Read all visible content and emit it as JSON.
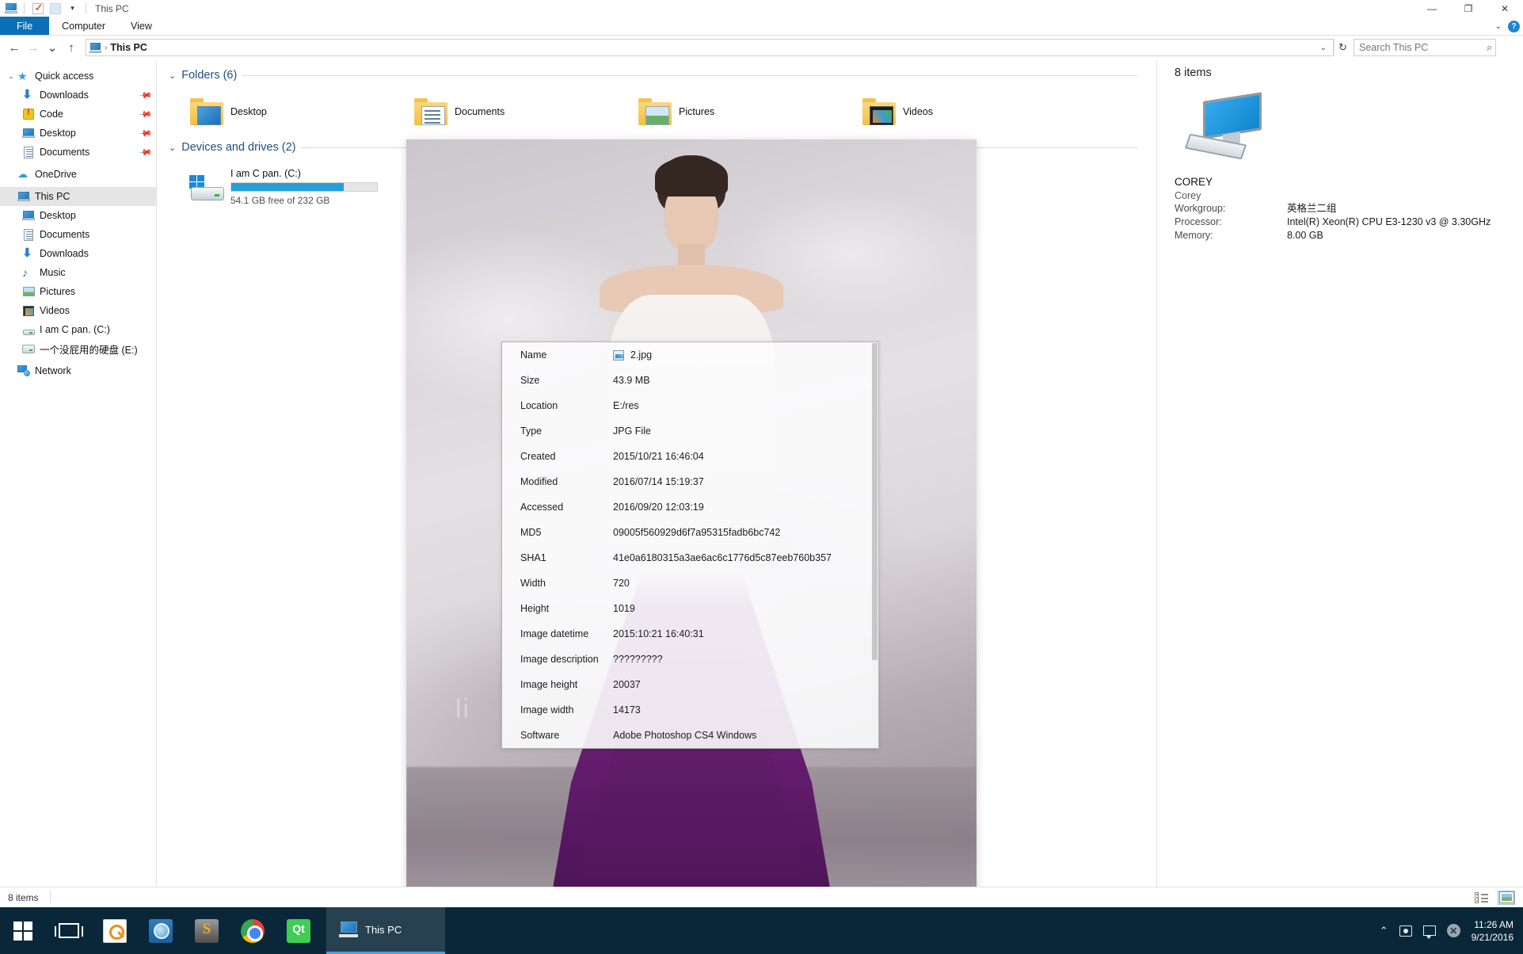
{
  "window": {
    "title": "This PC",
    "quick_access_icons": [
      "this-pc-icon",
      "checkbox-icon",
      "blank-icon",
      "dropdown-caret-icon"
    ],
    "controls": {
      "minimize": "—",
      "maximize": "❐",
      "close": "✕"
    }
  },
  "ribbon": {
    "tabs": [
      {
        "label": "File",
        "active": true
      },
      {
        "label": "Computer",
        "active": false
      },
      {
        "label": "View",
        "active": false
      }
    ],
    "collapse_icon": "chevron-down-icon",
    "help_icon": "help-icon",
    "help_label": "?"
  },
  "addressbar": {
    "back": "←",
    "forward": "→",
    "recent": "⌄",
    "up": "↑",
    "crumb_icon": "this-pc-icon",
    "crumb_sep": "›",
    "crumb_text": "This PC",
    "dropdown": "⌄",
    "refresh": "↻",
    "search_placeholder": "Search This PC",
    "search_value": "",
    "search_icon": "search-icon"
  },
  "sidebar": {
    "items": [
      {
        "label": "Quick access",
        "icon": "star-icon",
        "level": 0,
        "chevron": "⌄",
        "pinned": false,
        "selected": false
      },
      {
        "label": "Downloads",
        "icon": "download-icon",
        "level": 1,
        "chevron": "",
        "pinned": true,
        "selected": false
      },
      {
        "label": "Code",
        "icon": "folder-alert-icon",
        "level": 1,
        "chevron": "",
        "pinned": true,
        "selected": false
      },
      {
        "label": "Desktop",
        "icon": "monitor-icon",
        "level": 1,
        "chevron": "",
        "pinned": true,
        "selected": false
      },
      {
        "label": "Documents",
        "icon": "document-icon",
        "level": 1,
        "chevron": "",
        "pinned": true,
        "selected": false
      },
      {
        "label": "OneDrive",
        "icon": "cloud-icon",
        "level": 0,
        "chevron": "",
        "pinned": false,
        "selected": false
      },
      {
        "label": "This PC",
        "icon": "this-pc-icon",
        "level": 0,
        "chevron": "",
        "pinned": false,
        "selected": true
      },
      {
        "label": "Desktop",
        "icon": "monitor-icon",
        "level": 1,
        "chevron": "",
        "pinned": false,
        "selected": false
      },
      {
        "label": "Documents",
        "icon": "document-icon",
        "level": 1,
        "chevron": "",
        "pinned": false,
        "selected": false
      },
      {
        "label": "Downloads",
        "icon": "download-icon",
        "level": 1,
        "chevron": "",
        "pinned": false,
        "selected": false
      },
      {
        "label": "Music",
        "icon": "music-icon",
        "level": 1,
        "chevron": "",
        "pinned": false,
        "selected": false
      },
      {
        "label": "Pictures",
        "icon": "picture-icon",
        "level": 1,
        "chevron": "",
        "pinned": false,
        "selected": false
      },
      {
        "label": "Videos",
        "icon": "video-icon",
        "level": 1,
        "chevron": "",
        "pinned": false,
        "selected": false
      },
      {
        "label": "I am C pan. (C:)",
        "icon": "windows-drive-icon",
        "level": 1,
        "chevron": "",
        "pinned": false,
        "selected": false
      },
      {
        "label": "一个没屁用的硬盘 (E:)",
        "icon": "drive-icon",
        "level": 1,
        "chevron": "",
        "pinned": false,
        "selected": false
      },
      {
        "label": "Network",
        "icon": "network-icon",
        "level": 0,
        "chevron": "",
        "pinned": false,
        "selected": false
      }
    ]
  },
  "content": {
    "folders_group": {
      "chevron": "⌄",
      "title": "Folders (6)",
      "tiles": [
        {
          "label": "Desktop",
          "icon": "folder-desktop-icon"
        },
        {
          "label": "Documents",
          "icon": "folder-documents-icon"
        },
        {
          "label": "Pictures",
          "icon": "folder-pictures-icon"
        },
        {
          "label": "Videos",
          "icon": "folder-videos-icon"
        }
      ]
    },
    "drives_group": {
      "chevron": "⌄",
      "title": "Devices and drives (2)",
      "drives": [
        {
          "name": "I am C pan. (C:)",
          "free_text": "54.1 GB free of 232 GB",
          "used_percent": 77,
          "icon": "windows-drive-icon"
        },
        {
          "name": "",
          "free_text": "",
          "used_percent": 0,
          "icon": "drive-icon"
        }
      ]
    }
  },
  "details_pane": {
    "items_count": "8 items",
    "computer_icon": "computer-icon",
    "computer_name": "COREY",
    "user_name": "Corey",
    "rows": [
      {
        "key": "Workgroup:",
        "value": "英格兰二组"
      },
      {
        "key": "Processor:",
        "value": "Intel(R) Xeon(R) CPU E3-1230 v3 @ 3.30GHz"
      },
      {
        "key": "Memory:",
        "value": "8.00 GB"
      }
    ]
  },
  "preview": {
    "watermark": "li",
    "alt": "portrait-photo-preview"
  },
  "file_info": {
    "file_icon": "jpg-file-icon",
    "rows": [
      {
        "key": "Name",
        "value": "2.jpg",
        "has_icon": true
      },
      {
        "key": "Size",
        "value": "43.9 MB",
        "has_icon": false
      },
      {
        "key": "Location",
        "value": "E:/res",
        "has_icon": false
      },
      {
        "key": "Type",
        "value": "JPG File",
        "has_icon": false
      },
      {
        "key": "Created",
        "value": "2015/10/21 16:46:04",
        "has_icon": false
      },
      {
        "key": "Modified",
        "value": "2016/07/14 15:19:37",
        "has_icon": false
      },
      {
        "key": "Accessed",
        "value": "2016/09/20 12:03:19",
        "has_icon": false
      },
      {
        "key": "MD5",
        "value": "09005f560929d6f7a95315fadb6bc742",
        "has_icon": false
      },
      {
        "key": "SHA1",
        "value": "41e0a6180315a3ae6ac6c1776d5c87eeb760b357",
        "has_icon": false
      },
      {
        "key": "Width",
        "value": "720",
        "has_icon": false
      },
      {
        "key": "Height",
        "value": "1019",
        "has_icon": false
      },
      {
        "key": "Image datetime",
        "value": "2015:10:21 16:40:31",
        "has_icon": false
      },
      {
        "key": "Image description",
        "value": "?????????",
        "has_icon": false
      },
      {
        "key": "Image height",
        "value": "20037",
        "has_icon": false
      },
      {
        "key": "Image width",
        "value": "14173",
        "has_icon": false
      },
      {
        "key": "Software",
        "value": "Adobe Photoshop CS4 Windows",
        "has_icon": false
      }
    ]
  },
  "statusbar": {
    "items_text": "8 items",
    "view_details_icon": "details-view-icon",
    "view_large_icon": "large-icons-view-icon"
  },
  "taskbar": {
    "start_icon": "windows-start-icon",
    "taskview_icon": "task-view-icon",
    "apps": [
      {
        "icon": "everything-search-icon",
        "name": "everything"
      },
      {
        "icon": "dictionary-icon",
        "name": "dictionary"
      },
      {
        "icon": "sublime-text-icon",
        "name": "sublime-text"
      },
      {
        "icon": "chrome-icon",
        "name": "chrome"
      },
      {
        "icon": "qt-creator-icon",
        "name": "qt-creator"
      }
    ],
    "active_task": {
      "label": "This PC",
      "icon": "this-pc-icon"
    },
    "tray": {
      "show_hidden": "⌃",
      "network_icon": "network-tray-icon",
      "action_center_icon": "action-center-icon",
      "error_icon": "error-tray-icon",
      "time": "11:26 AM",
      "date": "9/21/2016"
    }
  },
  "colors": {
    "accent": "#0b6fb8",
    "drive_bar": "#26a0da",
    "taskbar": "#0a2739",
    "group_title": "#1f4f86"
  }
}
